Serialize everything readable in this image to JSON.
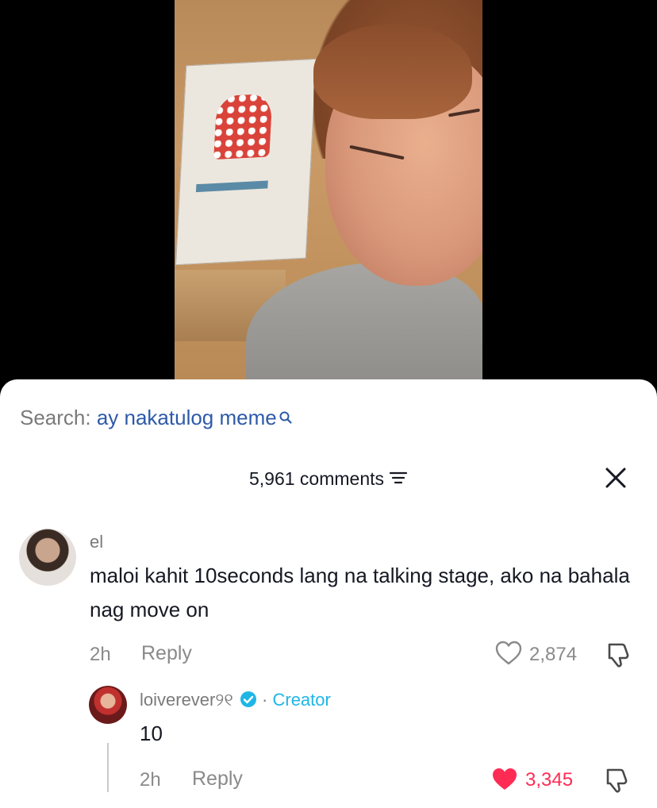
{
  "search": {
    "label": "Search: ",
    "query": "ay nakatulog meme"
  },
  "comments_header": {
    "count_text": "5,961 comments"
  },
  "comment": {
    "username": "el",
    "text": "maloi kahit 10seconds lang na talking stage, ako na bahala nag move on",
    "time": "2h",
    "reply_label": "Reply",
    "likes": "2,874"
  },
  "reply_comment": {
    "username": "loiverever",
    "username_suffix": "୨୧",
    "dot": " · ",
    "badge": "Creator",
    "text": "10",
    "time": "2h",
    "reply_label": "Reply",
    "likes": "3,345"
  },
  "colors": {
    "link_blue": "#2e5aa8",
    "creator_blue": "#1fb6e6",
    "like_red": "#fe2c55",
    "text_dark": "#161823",
    "text_gray": "#8a8a8a"
  },
  "icons": [
    "search-icon",
    "filter-icon",
    "close-icon",
    "heart-outline-icon",
    "heart-filled-icon",
    "dislike-icon",
    "verified-badge-icon"
  ]
}
